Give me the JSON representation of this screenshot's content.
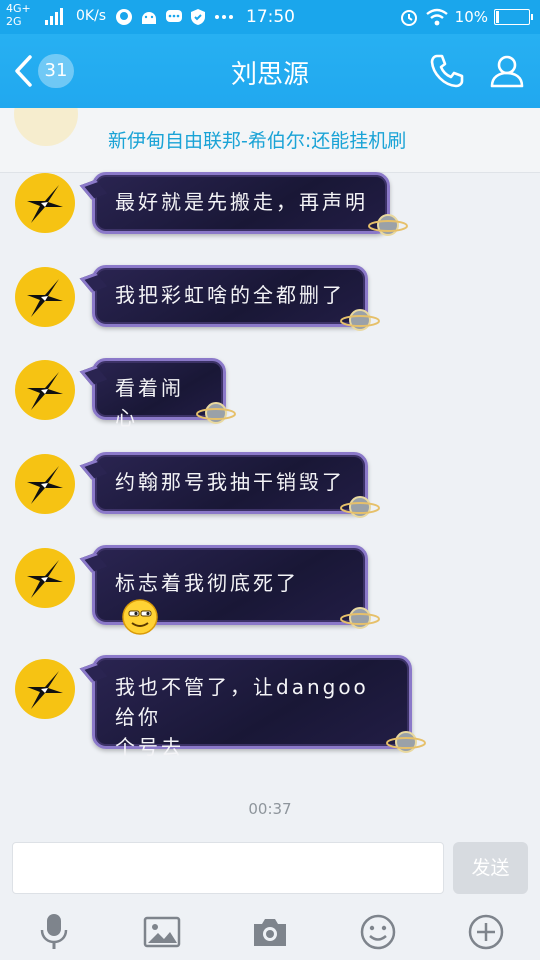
{
  "status_bar": {
    "network_top": "4G+",
    "network_bottom": "2G",
    "speed": "0K/s",
    "time": "17:50",
    "battery": "10%",
    "battery_level": 0.1
  },
  "header": {
    "back_badge": "31",
    "title": "刘思源"
  },
  "pinned_banner": {
    "text": "新伊甸自由联邦-希伯尔:还能挂机刷"
  },
  "messages": [
    {
      "text": "最好就是先搬走，再声明"
    },
    {
      "text": "我把彩虹啥的全都删了"
    },
    {
      "text": "看着闹心"
    },
    {
      "text": "约翰那号我抽干销毁了"
    },
    {
      "text": "标志着我彻底死了"
    },
    {
      "line1": "我也不管了，让dangoo给你",
      "line2": "个号去"
    }
  ],
  "timestamp": "00:37",
  "composer": {
    "placeholder": "",
    "send_label": "发送"
  },
  "colors": {
    "header_bg": "#21a8ef",
    "avatar_bg": "#f6c313",
    "bubble_bg": "#1d1a3c",
    "bubble_border": "#8b79c9",
    "banner_text": "#1aa3d6"
  },
  "icons": {
    "status": [
      "signal-icon",
      "qq-icon",
      "android-icon",
      "message-icon",
      "shield-icon",
      "more-icon",
      "alarm-icon",
      "wifi-icon",
      "battery-icon"
    ],
    "header": [
      "back-chevron-icon",
      "phone-icon",
      "user-icon"
    ],
    "toolbar": [
      "microphone-icon",
      "image-icon",
      "camera-icon",
      "emoji-icon",
      "plus-icon"
    ]
  }
}
